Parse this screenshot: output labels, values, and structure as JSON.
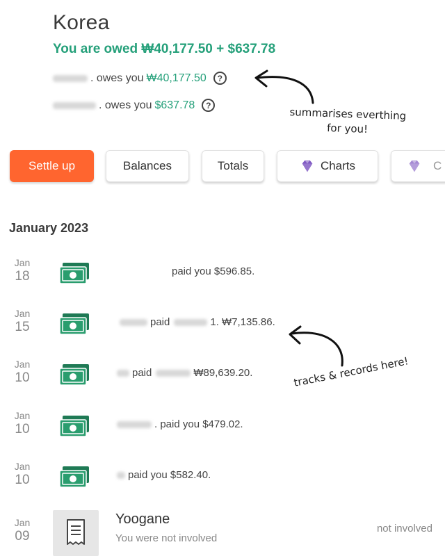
{
  "group": {
    "title": "Korea",
    "summary": "You are owed ₩40,177.50 + $637.78"
  },
  "balances": [
    {
      "name_tail": ". owes you",
      "amount": "₩40,177.50"
    },
    {
      "name_tail": ". owes you",
      "amount": "$637.78"
    }
  ],
  "buttons": {
    "settle_up": "Settle up",
    "balances": "Balances",
    "totals": "Totals",
    "charts": "Charts",
    "more": "C"
  },
  "notes": {
    "top": "summarises everthing for you!",
    "bottom": "tracks & records here!"
  },
  "month": "January 2023",
  "transactions": [
    {
      "month": "Jan",
      "day": "18",
      "text": "paid you $596.85."
    },
    {
      "month": "Jan",
      "day": "15",
      "text": "paid",
      "text2": "1. ₩7,135.86."
    },
    {
      "month": "Jan",
      "day": "10",
      "text": "paid",
      "text2": "₩89,639.20."
    },
    {
      "month": "Jan",
      "day": "10",
      "text": ". paid you $479.02."
    },
    {
      "month": "Jan",
      "day": "10",
      "text": "paid you $582.40."
    }
  ],
  "expense": {
    "month": "Jan",
    "day": "09",
    "title": "Yoogane",
    "subtitle": "You were not involved",
    "status": "not involved"
  },
  "colors": {
    "accent_green": "#25a07a",
    "settle_orange": "#ff652f",
    "gem_purple": "#7e57c2"
  },
  "icons": [
    "help-icon",
    "gem-icon",
    "cash-icon",
    "receipt-icon"
  ]
}
